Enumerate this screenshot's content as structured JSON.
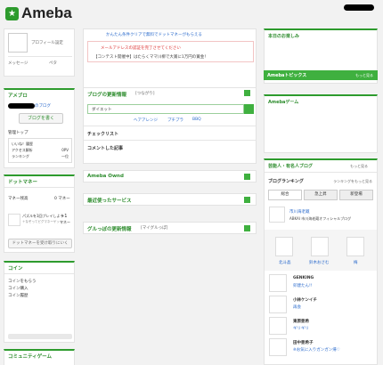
{
  "header": {
    "logo": "Ameba",
    "account_redacted": ""
  },
  "profile": {
    "settings": "プロフィール設定",
    "message": "メッセージ",
    "pe": "ペタ"
  },
  "ameblo": {
    "title": "アメブロ",
    "blog_link": "のブログ",
    "write_button": "ブログを書く",
    "manage_top": "管理トップ",
    "stats": [
      {
        "label": "いいね！履歴",
        "value": ""
      },
      {
        "label": "アクセス解析",
        "value": "0PV"
      },
      {
        "label": "ランキング",
        "value": "一位"
      }
    ]
  },
  "dotmoney": {
    "title": "ドットマネー",
    "held_label": "マネー残高",
    "held_value": "0 マネー",
    "promo_text": "パズルを1回プレイしよう",
    "promo_sub": "＋なぞってピグマネーゲット",
    "promo_reward": "+1",
    "promo_unit": "マネー",
    "receive_button": "ドットマネーを受け取りにいく"
  },
  "coin": {
    "title": "コイン",
    "links": [
      "コインをもらう",
      "コイン購入",
      "コイン履歴"
    ]
  },
  "community": {
    "title": "コミュニティゲーム"
  },
  "main": {
    "banner": "かんたん条件クリアで無料でドットマネーがもらえる",
    "alert_title": "メールアドレスの認証を完了させてください",
    "alert_body": "【コンテスト開催中】はたらくママ川柳で大賞に1万円の賞金！",
    "blog_updates_title": "ブログの更新情報",
    "blog_updates_tag": "[つながり]",
    "search_value": "ダイエット",
    "hair_links": [
      "ヘアアレンジ",
      "プチプラ",
      "BBQ"
    ],
    "checklist": "チェックリスト",
    "commented": "コメントした記事",
    "ameba_ownd": "Ameba Ownd",
    "recent_services": "最近使ったサービス",
    "gurupo_title": "グルっぽの更新情報",
    "gurupo_tag": "[マイグルっぽ]"
  },
  "right": {
    "today": "本日のお楽しみ",
    "topics_title": "Amebaトピックス",
    "topics_more": "もっと見る",
    "game_title": "Amebaゲーム",
    "celebs_title": "芸能人・有名人ブログ",
    "celebs_more": "もっと見る",
    "ranking_title": "ブログランキング",
    "ranking_more": "ランキングをもっと見る",
    "tabs": [
      "総合",
      "急上昇",
      "新登場"
    ],
    "top_blog_name": "市川海老蔵",
    "top_blog_desc": "ABKAI 市川海老蔵オフィシャルブログ",
    "avatars": [
      "北斗晶",
      "鈴木おさむ",
      "梅"
    ],
    "list": [
      {
        "name": "GENKING",
        "title": "卯建たん!!"
      },
      {
        "name": "小林ケンイチ",
        "title": "再会"
      },
      {
        "name": "東原亜希",
        "title": "ギリギリ"
      },
      {
        "name": "田中亜希子",
        "title": "※お気に入りガンガン帰♡"
      }
    ]
  }
}
